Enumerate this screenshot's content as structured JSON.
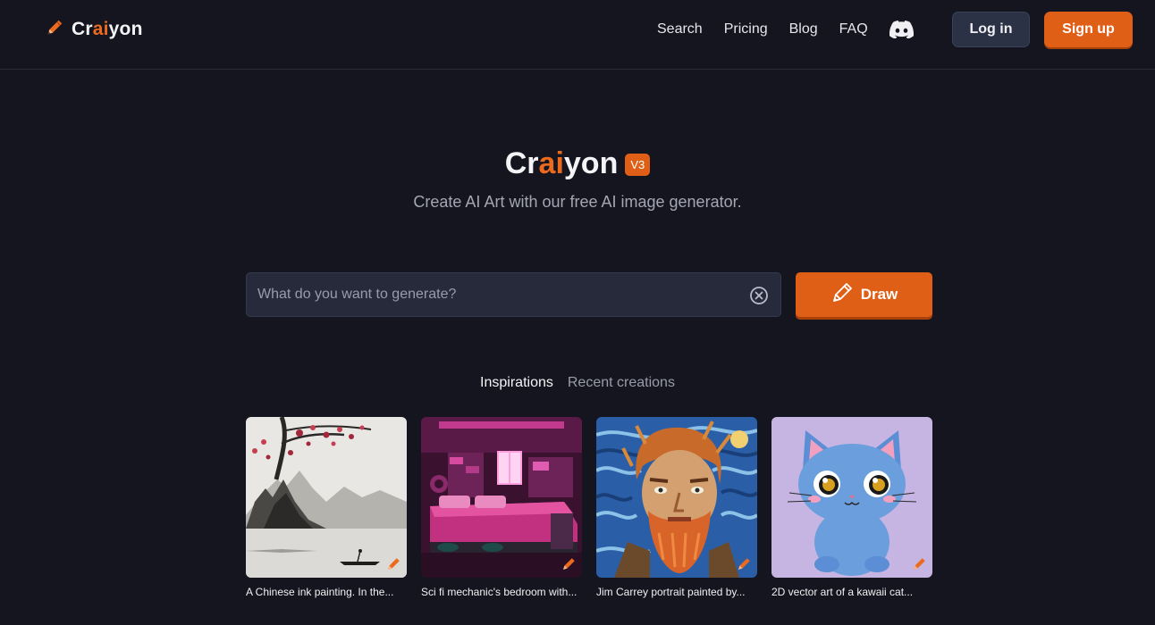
{
  "header": {
    "logo_prefix": "Cr",
    "logo_highlight": "ai",
    "logo_suffix": "yon",
    "nav": [
      "Search",
      "Pricing",
      "Blog",
      "FAQ"
    ],
    "login_label": "Log in",
    "signup_label": "Sign up"
  },
  "hero": {
    "title_prefix": "Cr",
    "title_highlight": "ai",
    "title_suffix": "yon",
    "version": "V3",
    "subtitle": "Create AI Art with our free AI image generator."
  },
  "search": {
    "placeholder": "What do you want to generate?",
    "value": "",
    "draw_label": "Draw"
  },
  "tabs": {
    "inspirations": "Inspirations",
    "recent": "Recent creations",
    "active": "Inspirations"
  },
  "gallery": [
    {
      "caption": "A Chinese ink painting. In the..."
    },
    {
      "caption": "Sci fi mechanic's bedroom with..."
    },
    {
      "caption": "Jim Carrey portrait painted by..."
    },
    {
      "caption": "2D vector art of a kawaii cat..."
    }
  ],
  "colors": {
    "background": "#15151f",
    "accent": "#e05f17",
    "login_button": "#2b3245",
    "input_background": "#262a3a"
  },
  "icons": {
    "logo": "pencil-icon",
    "discord": "discord-icon",
    "clear": "close-circle-icon",
    "draw": "pencil-icon"
  }
}
